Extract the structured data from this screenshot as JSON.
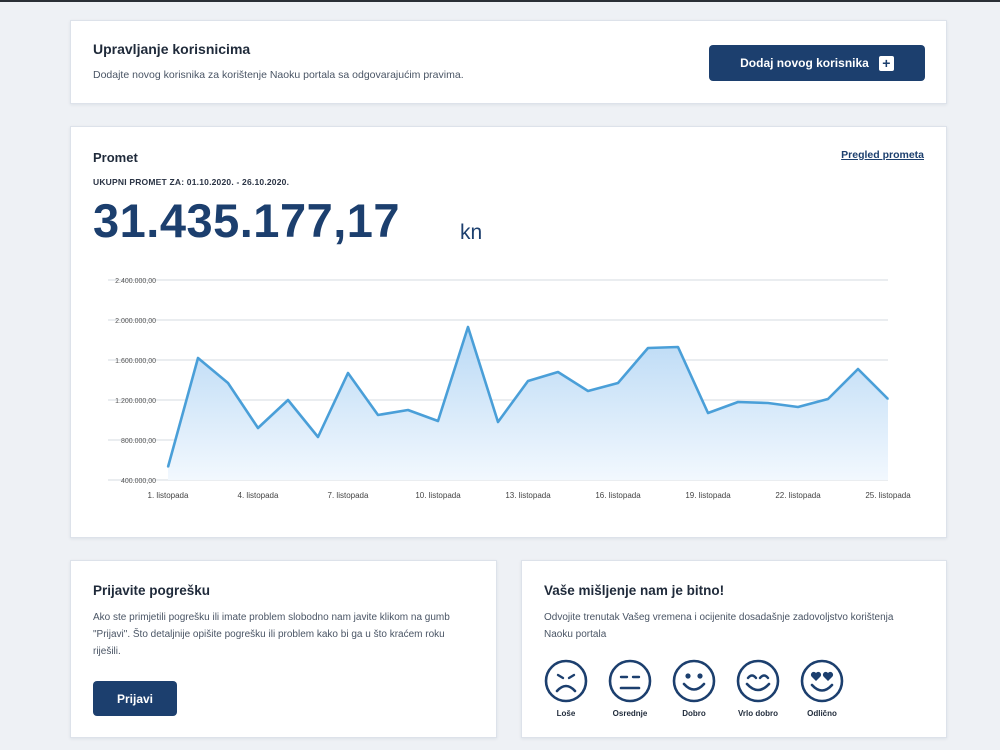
{
  "users_card": {
    "title": "Upravljanje korisnicima",
    "description": "Dodajte novog korisnika za korištenje Naoku portala sa odgovarajućim pravima.",
    "add_button_label": "Dodaj novog korisnika",
    "add_button_icon": "plus-icon"
  },
  "turnover_card": {
    "title": "Promet",
    "link_label": "Pregled prometa",
    "period_label": "UKUPNI PROMET ZA: 01.10.2020. - 26.10.2020.",
    "total_amount": "31.435.177,17",
    "currency": "kn"
  },
  "chart_data": {
    "type": "area",
    "title": "",
    "xlabel": "",
    "ylabel": "",
    "ylim": [
      400000,
      2400000
    ],
    "y_ticks": [
      {
        "value": 400000,
        "label": "400.000,00"
      },
      {
        "value": 800000,
        "label": "800.000,00"
      },
      {
        "value": 1200000,
        "label": "1.200.000,00"
      },
      {
        "value": 1600000,
        "label": "1.600.000,00"
      },
      {
        "value": 2000000,
        "label": "2.000.000,00"
      },
      {
        "value": 2400000,
        "label": "2.400.000,00"
      }
    ],
    "x_tick_labels": [
      {
        "index": 0,
        "label": "1. listopada"
      },
      {
        "index": 3,
        "label": "4. listopada"
      },
      {
        "index": 6,
        "label": "7. listopada"
      },
      {
        "index": 9,
        "label": "10. listopada"
      },
      {
        "index": 12,
        "label": "13. listopada"
      },
      {
        "index": 15,
        "label": "16. listopada"
      },
      {
        "index": 18,
        "label": "19. listopada"
      },
      {
        "index": 21,
        "label": "22. listopada"
      },
      {
        "index": 24,
        "label": "25. listopada"
      }
    ],
    "series": [
      {
        "values": [
          530000,
          1620000,
          1370000,
          920000,
          1200000,
          830000,
          1470000,
          1050000,
          1100000,
          990000,
          1930000,
          980000,
          1390000,
          1480000,
          1290000,
          1370000,
          1720000,
          1730000,
          1070000,
          1180000,
          1170000,
          1130000,
          1210000,
          1510000,
          1210000
        ]
      }
    ],
    "grid": true,
    "line_color": "#4a9fd8",
    "fill_top_color": "#b9d9f5",
    "fill_bottom_color": "#f2f8fe"
  },
  "report_card": {
    "title": "Prijavite pogrešku",
    "text": "Ako ste primjetili pogrešku ili imate problem slobodno nam javite klikom na gumb \"Prijavi\". Što detaljnije opišite pogrešku ili problem kako bi ga u što kraćem roku riješili.",
    "button_label": "Prijavi"
  },
  "opinion_card": {
    "title": "Vaše mišljenje nam je bitno!",
    "text": "Odvojite trenutak Vašeg vremena i ocijenite dosadašnje zadovoljstvo korištenja Naoku portala",
    "ratings": [
      {
        "label": "Loše",
        "icon": "sad-face-icon"
      },
      {
        "label": "Osrednje",
        "icon": "neutral-face-icon"
      },
      {
        "label": "Dobro",
        "icon": "smile-face-icon"
      },
      {
        "label": "Vrlo dobro",
        "icon": "happy-face-icon"
      },
      {
        "label": "Odlično",
        "icon": "heart-eyes-face-icon"
      }
    ]
  },
  "colors": {
    "primary": "#1c3f6e",
    "background": "#eef1f5",
    "chart_line": "#4a9fd8"
  }
}
